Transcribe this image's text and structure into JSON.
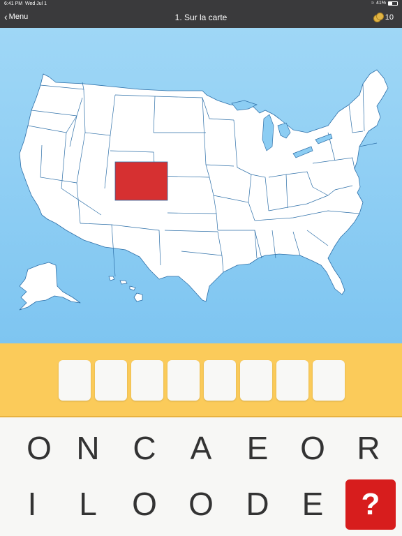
{
  "status_bar": {
    "time": "6:41 PM",
    "date": "Wed Jul 1",
    "battery": "41%"
  },
  "nav": {
    "back_label": "Menu",
    "title": "1. Sur la carte",
    "coins": "10"
  },
  "map": {
    "highlighted_state": "Colorado",
    "highlight_color": "#d63031",
    "ocean_color": "#8ccdf3",
    "land_color": "#ffffff"
  },
  "answer": {
    "slots": [
      "",
      "",
      "",
      "",
      "",
      "",
      "",
      ""
    ]
  },
  "keyboard": {
    "row1": [
      "O",
      "N",
      "C",
      "A",
      "E",
      "O",
      "R"
    ],
    "row2": [
      "I",
      "L",
      "O",
      "O",
      "D",
      "E"
    ],
    "help_label": "?"
  },
  "colors": {
    "top_bar": "#3a3a3c",
    "answer_band": "#fbcb5a",
    "help_button": "#d71d1d"
  }
}
